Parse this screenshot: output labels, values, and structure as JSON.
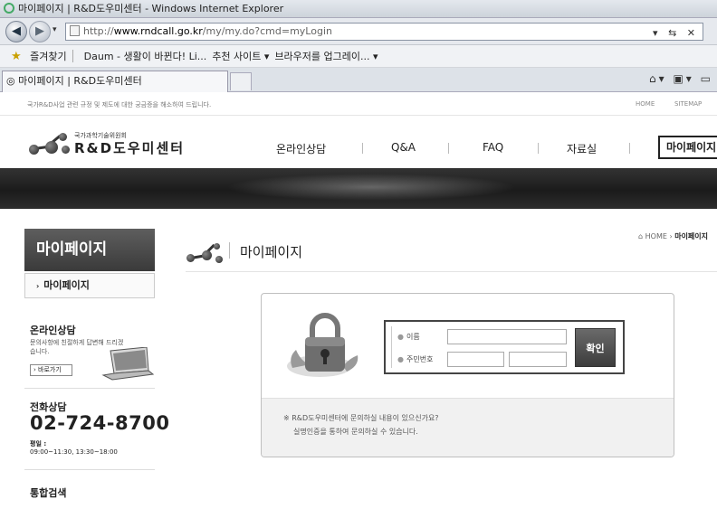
{
  "browser": {
    "window_title": "마이페이지 | R&D도우미센터 - Windows Internet Explorer",
    "address": {
      "protocol": "http://",
      "host": "www.rndcall.go.kr",
      "path": "/my/my.do?cmd=myLogin"
    },
    "favorites": {
      "label": "즐겨찾기",
      "items": [
        "Daum - 생활이 바뀐다! Li...",
        "추천 사이트 ▾",
        "브라우저를 업그레이... ▾"
      ]
    },
    "tab_title": "마이페이지 | R&D도우미센터",
    "icons": [
      "ie-icon",
      "back-icon",
      "forward-icon",
      "star-icon",
      "home-icon",
      "feed-icon"
    ]
  },
  "site": {
    "tagline": "국가R&D사업 관련 규정 및 제도에 대한 궁금증을 해소하여 드립니다.",
    "util_links": [
      "HOME",
      "SITEMAP"
    ],
    "logo": {
      "sub": "국가과학기술위원회",
      "main": "R&D도우미센터"
    },
    "nav": [
      "온라인상담",
      "Q&A",
      "FAQ",
      "자료실",
      "마이페이지"
    ]
  },
  "sidebar": {
    "title": "마이페이지",
    "items": [
      "마이페이지"
    ],
    "online": {
      "title": "온라인상담",
      "desc": "문의사항에 친절하게 답변해 드리겠습니다.",
      "button": "바로가기"
    },
    "phone": {
      "title": "전화상담",
      "number": "02-724-8700",
      "hours_label": "평일 :",
      "hours": "09:00~11:30, 13:30~18:00"
    },
    "search": {
      "title": "통합검색"
    }
  },
  "content": {
    "breadcrumb": {
      "home": "HOME",
      "current": "마이페이지"
    },
    "title": "마이페이지",
    "form": {
      "name_label": "이름",
      "id_label": "주민번호",
      "submit": "확인"
    },
    "notice": {
      "line1": "※ R&D도우미센터에 문의하실 내용이 있으신가요?",
      "line2": "실명인증을 통하여 문의하실 수 있습니다."
    }
  }
}
